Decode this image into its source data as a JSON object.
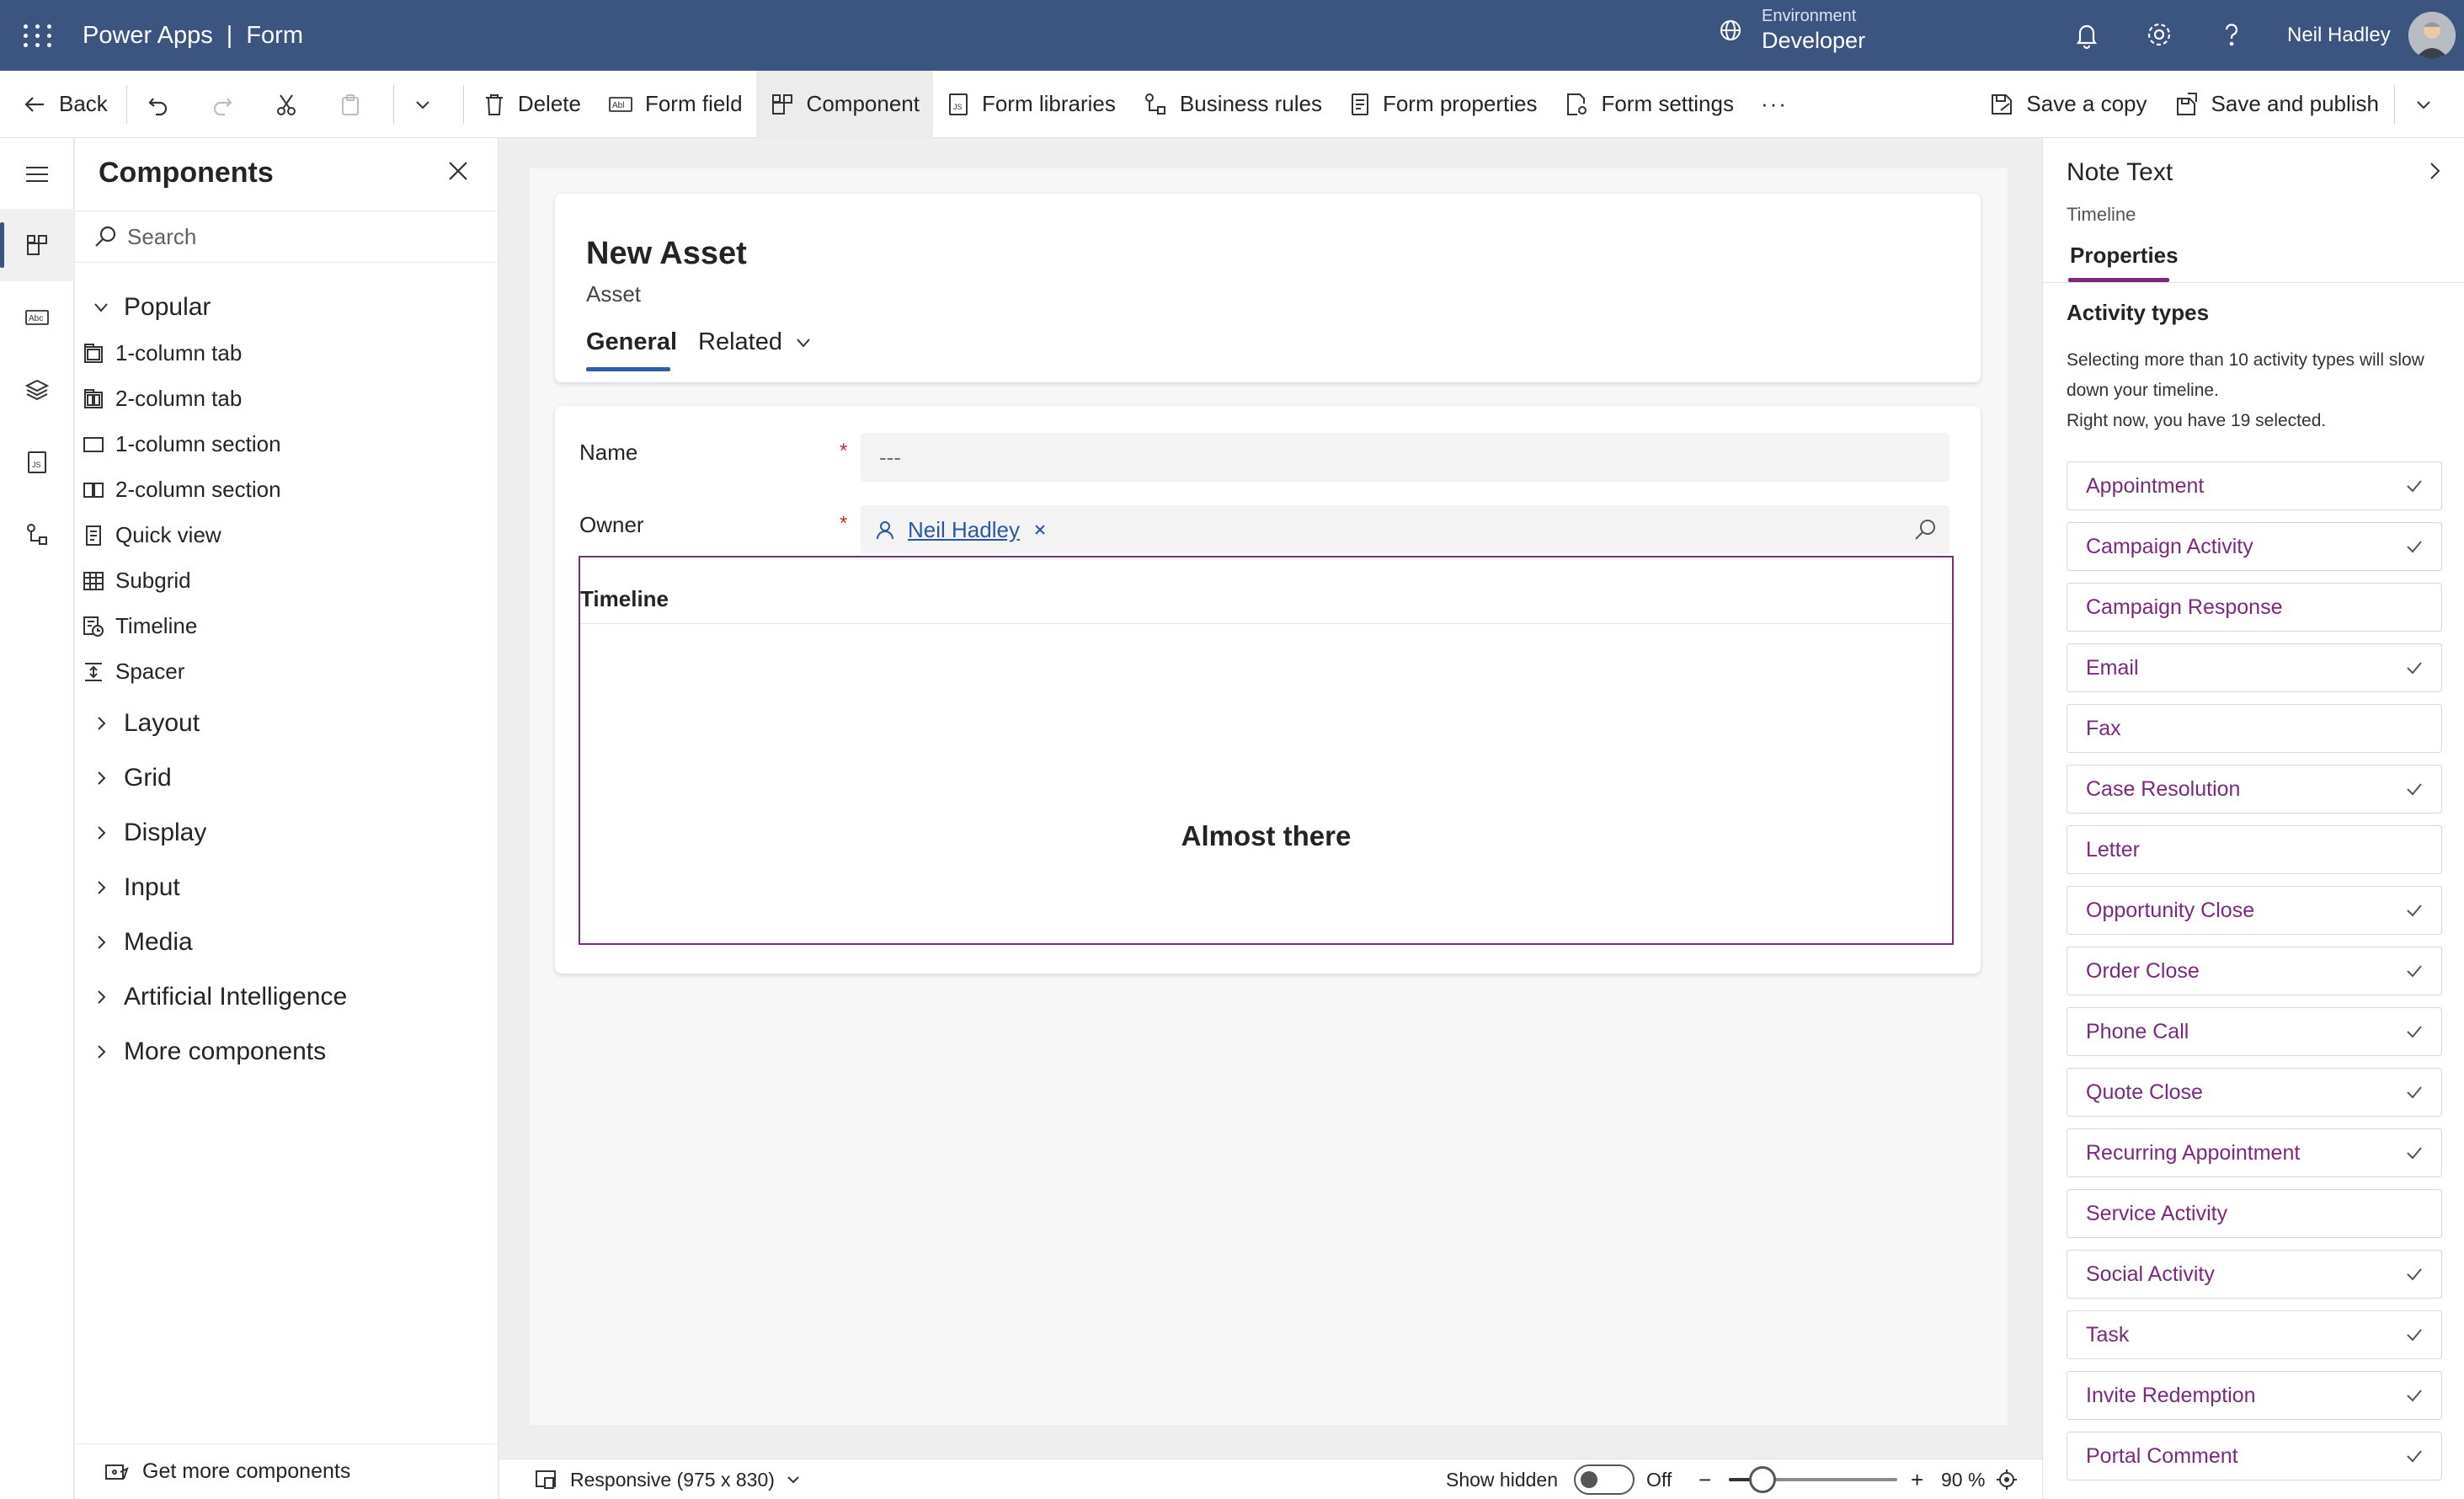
{
  "topbar": {
    "app_name": "Power Apps",
    "separator": "|",
    "page_name": "Form",
    "environment_label": "Environment",
    "environment_name": "Developer",
    "user_name": "Neil Hadley"
  },
  "command_bar": {
    "back": "Back",
    "delete": "Delete",
    "form_field": "Form field",
    "component": "Component",
    "form_libraries": "Form libraries",
    "business_rules": "Business rules",
    "form_properties": "Form properties",
    "form_settings": "Form settings",
    "more": "···",
    "save_copy": "Save a copy",
    "save_publish": "Save and publish"
  },
  "components_pane": {
    "title": "Components",
    "search_placeholder": "Search",
    "popular_label": "Popular",
    "popular_items": [
      "1-column tab",
      "2-column tab",
      "1-column section",
      "2-column section",
      "Quick view",
      "Subgrid",
      "Timeline",
      "Spacer"
    ],
    "categories": [
      "Layout",
      "Grid",
      "Display",
      "Input",
      "Media",
      "Artificial Intelligence",
      "More components"
    ],
    "get_more": "Get more components"
  },
  "form": {
    "title": "New Asset",
    "entity": "Asset",
    "tabs": [
      "General",
      "Related"
    ],
    "fields": {
      "name_label": "Name",
      "name_value": "---",
      "owner_label": "Owner",
      "owner_value": "Neil Hadley",
      "required_mark": "*"
    },
    "timeline_title": "Timeline",
    "timeline_message": "Almost there"
  },
  "status_bar": {
    "device": "Responsive (975 x 830)",
    "show_hidden_label": "Show hidden",
    "show_hidden_state": "Off",
    "zoom_minus": "−",
    "zoom_plus": "+",
    "zoom_text": "90 %",
    "zoom_level_fraction": 0.2
  },
  "properties_pane": {
    "title": "Note Text",
    "subtitle": "Timeline",
    "tab": "Properties",
    "section_title": "Activity types",
    "help_line1": "Selecting more than 10 activity types will slow down your timeline.",
    "help_line2": "Right now, you have 19 selected.",
    "activity_types": [
      {
        "label": "Appointment",
        "checked": true
      },
      {
        "label": "Campaign Activity",
        "checked": true
      },
      {
        "label": "Campaign Response",
        "checked": false
      },
      {
        "label": "Email",
        "checked": true
      },
      {
        "label": "Fax",
        "checked": false
      },
      {
        "label": "Case Resolution",
        "checked": true
      },
      {
        "label": "Letter",
        "checked": false
      },
      {
        "label": "Opportunity Close",
        "checked": true
      },
      {
        "label": "Order Close",
        "checked": true
      },
      {
        "label": "Phone Call",
        "checked": true
      },
      {
        "label": "Quote Close",
        "checked": true
      },
      {
        "label": "Recurring Appointment",
        "checked": true
      },
      {
        "label": "Service Activity",
        "checked": false
      },
      {
        "label": "Social Activity",
        "checked": true
      },
      {
        "label": "Task",
        "checked": true
      },
      {
        "label": "Invite Redemption",
        "checked": true
      },
      {
        "label": "Portal Comment",
        "checked": true
      }
    ]
  },
  "colors": {
    "topbar": "#3b5580",
    "accent_purple": "#7b2a7b",
    "link_blue": "#2a57a8",
    "required_red": "#b83535"
  }
}
